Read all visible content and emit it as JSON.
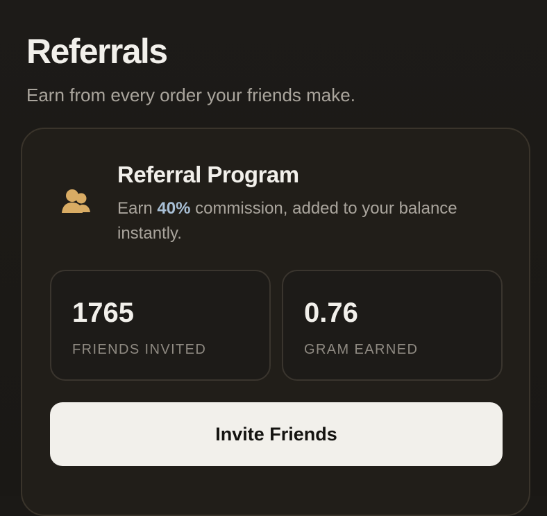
{
  "header": {
    "title": "Referrals",
    "subtitle": "Earn from every order your friends make."
  },
  "referral_card": {
    "icon": "users-icon",
    "title": "Referral Program",
    "description_prefix": "Earn ",
    "commission": "40%",
    "description_suffix": " commission, added to your balance instantly.",
    "stats": [
      {
        "value": "1765",
        "label": "Friends Invited"
      },
      {
        "value": "0.76",
        "label": "Gram Earned"
      }
    ],
    "button_label": "Invite Friends"
  },
  "colors": {
    "background": "#1b1916",
    "card_background": "#211e19",
    "card_border": "#3a342b",
    "accent": "#a8bfd5",
    "icon": "#d9ac64",
    "button_background": "#f2f0eb",
    "button_text": "#141310"
  }
}
